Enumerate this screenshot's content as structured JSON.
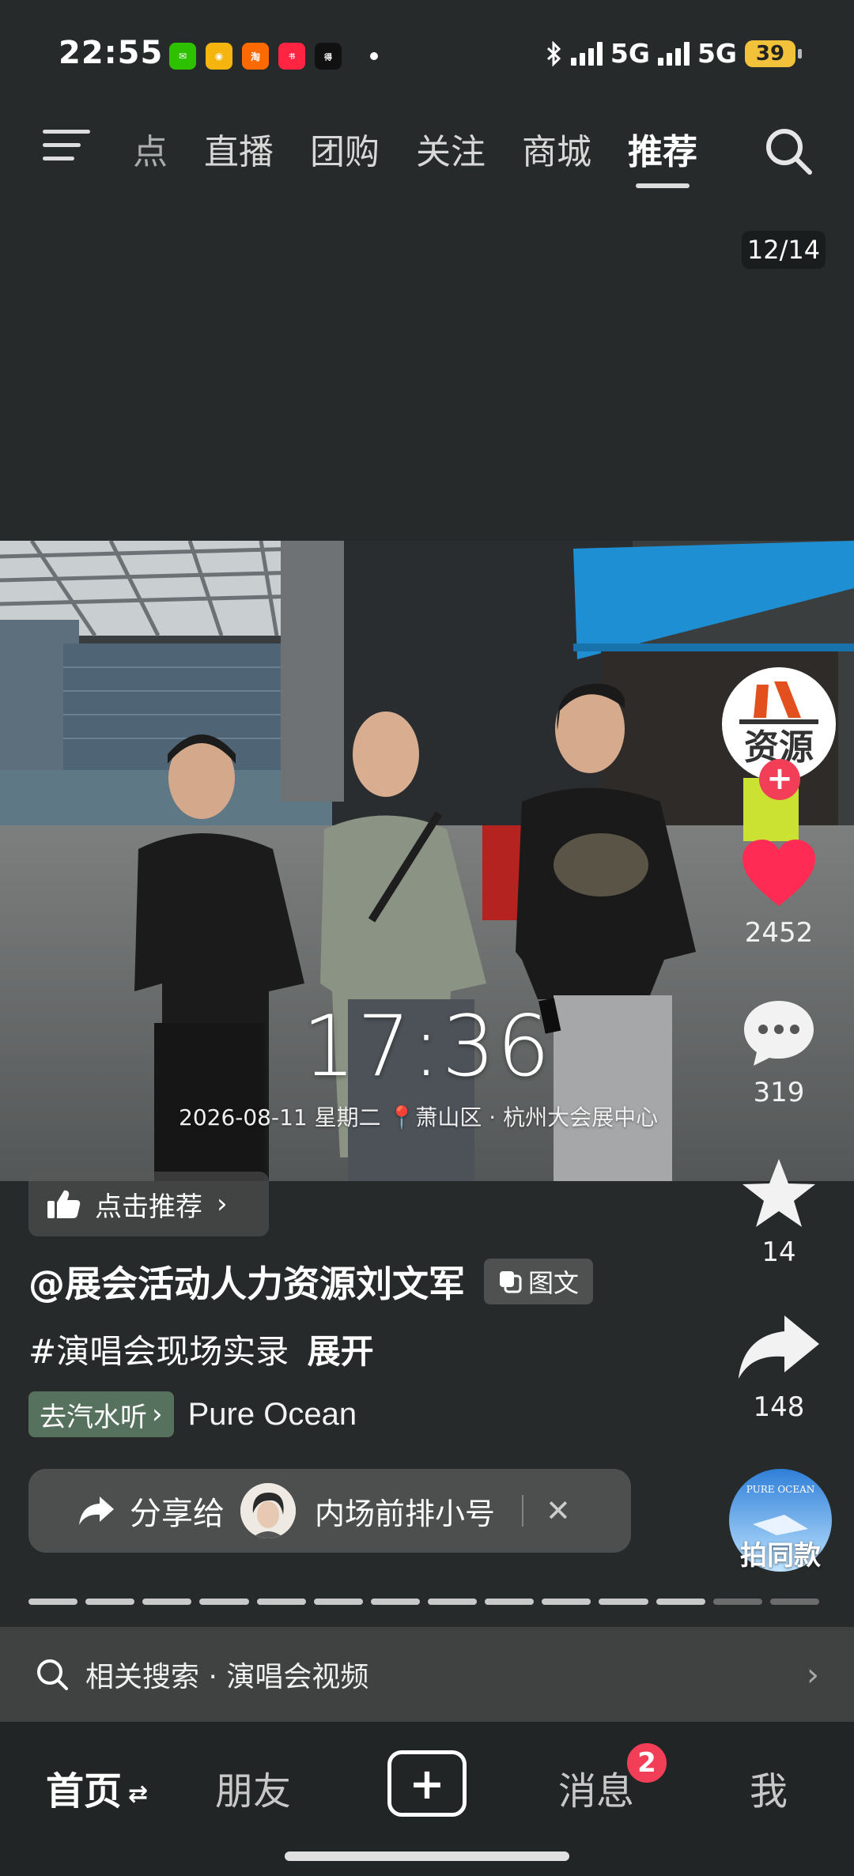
{
  "status_bar": {
    "time": "22:55",
    "app_icons": [
      {
        "name": "wechat",
        "color": "#2dc100",
        "glyph": "💬"
      },
      {
        "name": "weibo",
        "color": "#f5b50e",
        "glyph": "◉"
      },
      {
        "name": "taobao",
        "color": "#ff6a00",
        "glyph": "淘"
      },
      {
        "name": "xiaohongshu",
        "color": "#ff2442",
        "glyph": "小红书"
      },
      {
        "name": "dewu",
        "color": "#111111",
        "glyph": "得物"
      }
    ],
    "network_1": "5G",
    "network_2": "5G",
    "battery": "39"
  },
  "top_nav": {
    "tabs": [
      {
        "label": "热点"
      },
      {
        "label": "直播"
      },
      {
        "label": "团购"
      },
      {
        "label": "关注"
      },
      {
        "label": "商城"
      },
      {
        "label": "推荐",
        "active": true
      }
    ]
  },
  "page_counter": "12/14",
  "photo": {
    "time": "17:36",
    "meta": "2026-08-11  星期二  📍萧山区 · 杭州大会展中心"
  },
  "right_rail": {
    "avatar_text": "资源",
    "like_count": "2452",
    "comment_count": "319",
    "favorite_count": "14",
    "share_count": "148",
    "colors": {
      "like": "#fe2c55",
      "follow": "#f23e56"
    }
  },
  "recommend_button": {
    "label": "点击推荐"
  },
  "post": {
    "author": "@展会活动人力资源刘文军",
    "type_badge": "图文",
    "caption": "#演唱会现场实录",
    "expand": "展开",
    "music_chip": "去汽水听",
    "music_title": "Pure Ocean"
  },
  "share_bar": {
    "label": "分享给",
    "target": "内场前排小号"
  },
  "same_style": {
    "label": "拍同款",
    "disc_text": "PURE OCEAN"
  },
  "progress": {
    "total": 14,
    "current": 12
  },
  "related_search": {
    "text": "相关搜索 · 演唱会视频"
  },
  "bottom_nav": {
    "home": "首页",
    "friends": "朋友",
    "messages": "消息",
    "message_badge": "2",
    "me": "我"
  }
}
